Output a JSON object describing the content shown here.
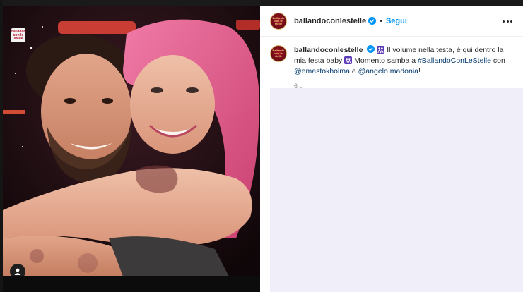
{
  "post": {
    "author": "ballandoconlestelle",
    "follow_label": "Segui",
    "separator": "•",
    "media_logo_text": "Ballando con le stelle",
    "avatar_text": "Ballando con le stelle",
    "caption": {
      "author": "ballandoconlestelle",
      "text_part1": "Il volume nella testa, è qui dentro la mia festa baby",
      "text_part2": "Momento samba a",
      "hashtag": "#BallandoConLeStelle",
      "text_part3": "con",
      "mention_1": "@emastokholma",
      "text_part4": "e",
      "mention_2": "@angelo.madonia",
      "text_part5": "!"
    },
    "time_ago": "6 g"
  },
  "icons": {
    "verified": "verified-badge-icon",
    "more": "more-options-icon",
    "user_tag": "user-tag-icon",
    "emoji": "dancing-women-emoji-icon"
  },
  "colors": {
    "follow": "#0095f6",
    "link": "#00376b",
    "verified": "#0095f6",
    "overlay": "#f0eef8"
  }
}
